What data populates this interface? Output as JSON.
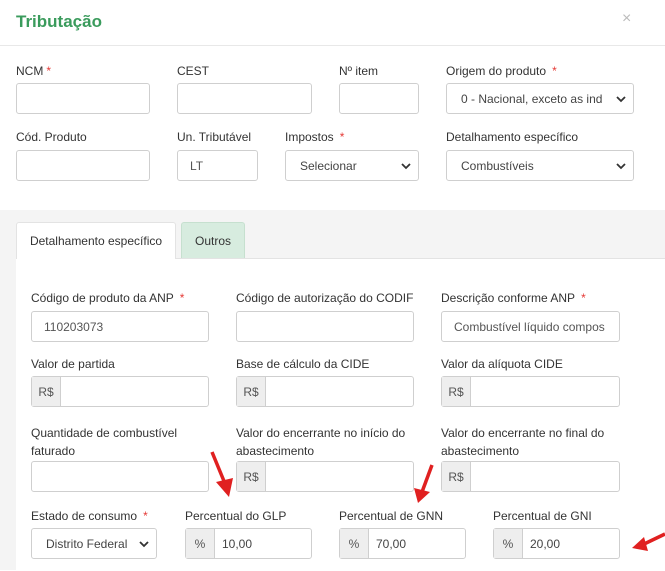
{
  "modal": {
    "title": "Tributação",
    "close": "×"
  },
  "fields": {
    "ncm": {
      "label": "NCM",
      "required": "*",
      "value": ""
    },
    "cest": {
      "label": "CEST",
      "value": ""
    },
    "item_no": {
      "label": "Nº item",
      "value": ""
    },
    "origem": {
      "label": "Origem do produto",
      "required": "*",
      "value": "0 - Nacional, exceto as ind"
    },
    "cod_produto": {
      "label": "Cód. Produto",
      "value": ""
    },
    "un_tributavel": {
      "label": "Un. Tributável",
      "value": "LT"
    },
    "impostos": {
      "label": "Impostos",
      "required": "*",
      "value": "Selecionar"
    },
    "detalhamento": {
      "label": "Detalhamento específico",
      "value": "Combustíveis"
    }
  },
  "tabs": [
    {
      "label": "Detalhamento específico",
      "active": true
    },
    {
      "label": "Outros",
      "active": false
    }
  ],
  "fuel": {
    "cod_anp": {
      "label": "Código de produto da ANP",
      "required": "*",
      "value": "110203073"
    },
    "codif": {
      "label": "Código de autorização do CODIF",
      "value": ""
    },
    "desc_anp": {
      "label": "Descrição conforme ANP",
      "required": "*",
      "value": "Combustível líquido compos"
    },
    "valor_partida": {
      "label": "Valor de partida",
      "prefix": "R$",
      "value": ""
    },
    "base_cide": {
      "label": "Base de cálculo da CIDE",
      "prefix": "R$",
      "value": ""
    },
    "aliquota_cide": {
      "label": "Valor da alíquota CIDE",
      "prefix": "R$",
      "value": ""
    },
    "qtd_faturado": {
      "label_line1": "Quantidade de combustível",
      "label_line2": "faturado",
      "value": ""
    },
    "encerrante_inicio": {
      "label_line1": "Valor do encerrante no início do",
      "label_line2": "abastecimento",
      "prefix": "R$",
      "value": ""
    },
    "encerrante_final": {
      "label_line1": "Valor do encerrante no final do",
      "label_line2": "abastecimento",
      "prefix": "R$",
      "value": ""
    },
    "estado_consumo": {
      "label": "Estado de consumo",
      "required": "*",
      "value": "Distrito Federal"
    },
    "perc_glp": {
      "label": "Percentual do GLP",
      "prefix": "%",
      "value": "10,00"
    },
    "perc_gnn": {
      "label": "Percentual de GNN",
      "prefix": "%",
      "value": "70,00"
    },
    "perc_gni": {
      "label": "Percentual de GNI",
      "prefix": "%",
      "value": "20,00"
    }
  },
  "colors": {
    "accent": "#3a9b5c",
    "required": "#e53935",
    "annotation_arrow": "#e02020"
  }
}
